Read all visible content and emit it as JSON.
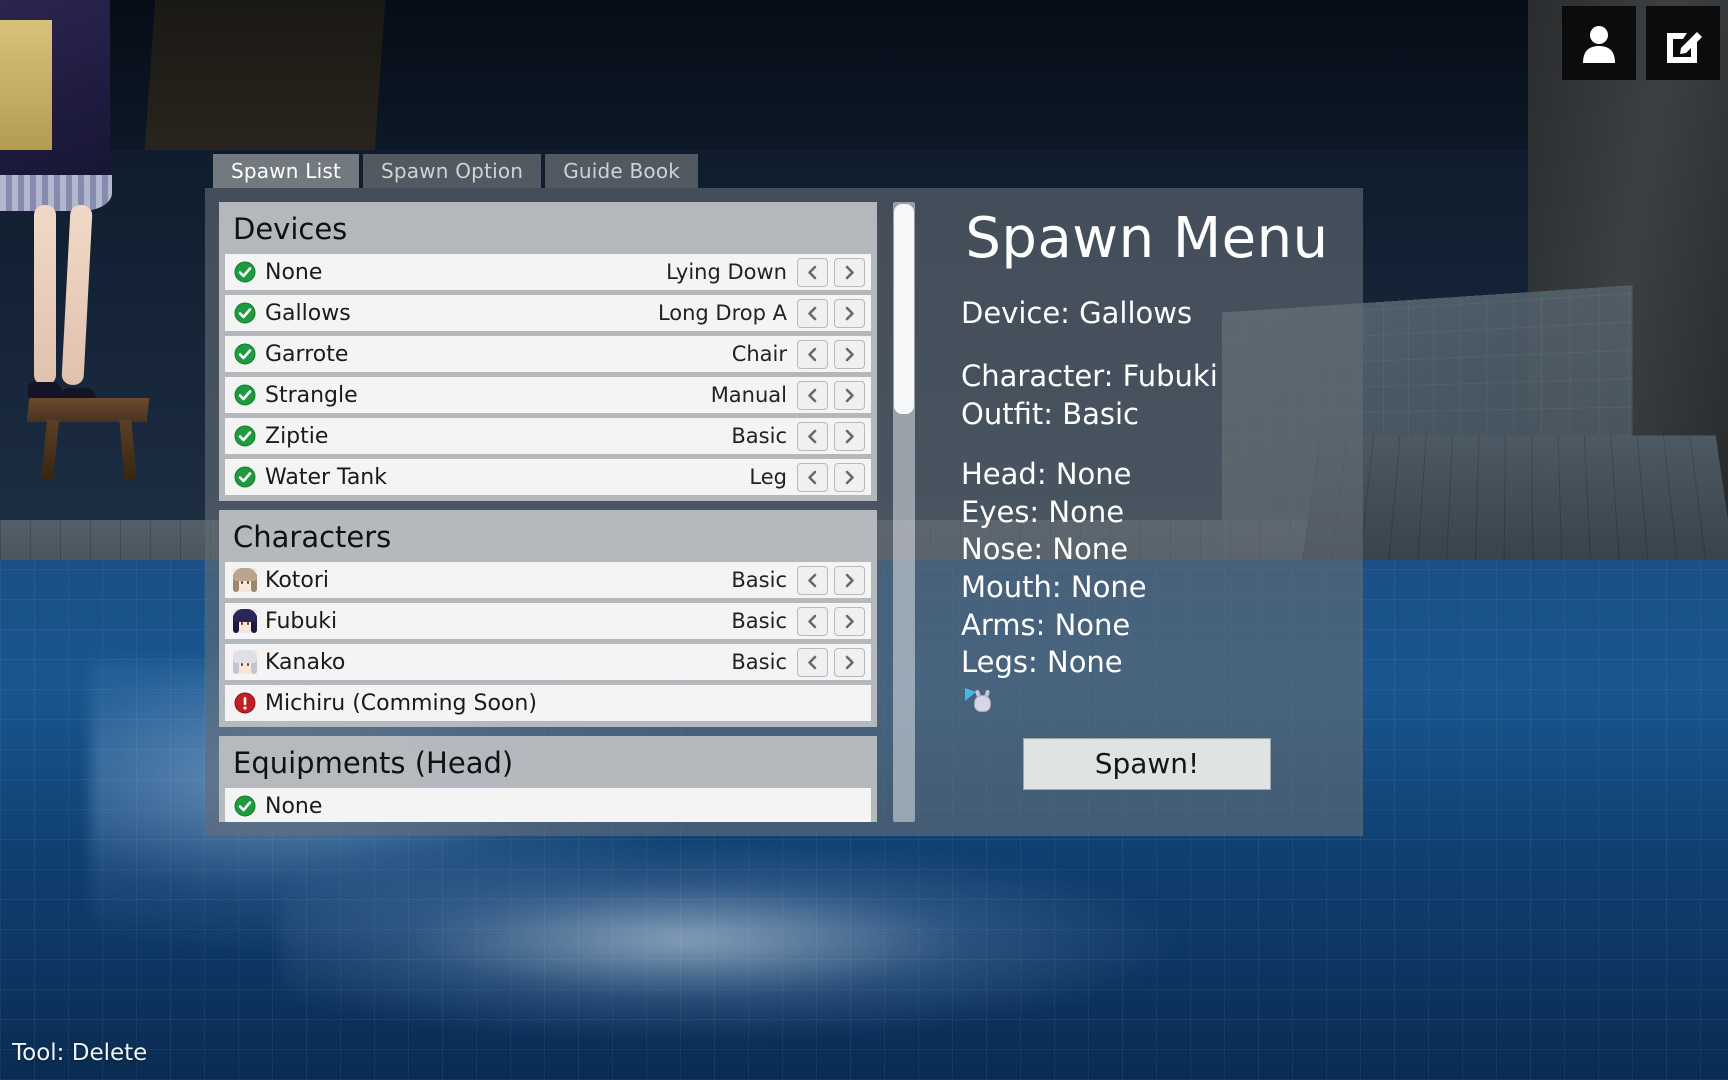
{
  "topbar": {
    "profile_icon": "person-icon",
    "edit_icon": "edit-compose-icon"
  },
  "tabs": [
    {
      "label": "Spawn List",
      "active": true
    },
    {
      "label": "Spawn Option",
      "active": false
    },
    {
      "label": "Guide Book",
      "active": false
    }
  ],
  "list": {
    "groups": [
      {
        "title": "Devices",
        "rows": [
          {
            "icon": "green-check-icon",
            "label": "None",
            "value": "Lying Down",
            "arrows": true
          },
          {
            "icon": "green-check-icon",
            "label": "Gallows",
            "value": "Long Drop A",
            "arrows": true
          },
          {
            "icon": "green-check-icon",
            "label": "Garrote",
            "value": "Chair",
            "arrows": true
          },
          {
            "icon": "green-check-icon",
            "label": "Strangle",
            "value": "Manual",
            "arrows": true
          },
          {
            "icon": "green-check-icon",
            "label": "Ziptie",
            "value": "Basic",
            "arrows": true
          },
          {
            "icon": "green-check-icon",
            "label": "Water Tank",
            "value": "Leg",
            "arrows": true
          }
        ]
      },
      {
        "title": "Characters",
        "rows": [
          {
            "icon": "avatar-kotori",
            "label": "Kotori",
            "value": "Basic",
            "arrows": true
          },
          {
            "icon": "avatar-fubuki",
            "label": "Fubuki",
            "value": "Basic",
            "arrows": true
          },
          {
            "icon": "avatar-kanako",
            "label": "Kanako",
            "value": "Basic",
            "arrows": true
          },
          {
            "icon": "red-warning-icon",
            "label": "Michiru (Comming Soon)",
            "value": "",
            "arrows": false
          }
        ]
      },
      {
        "title": "Equipments (Head)",
        "rows": [
          {
            "icon": "green-check-icon",
            "label": "None",
            "value": "",
            "arrows": false
          }
        ]
      }
    ],
    "scroll_position": "top"
  },
  "info": {
    "title": "Spawn Menu",
    "device": "Device: Gallows",
    "character": "Character: Fubuki",
    "outfit": "Outfit: Basic",
    "head": "Head: None",
    "eyes": "Eyes: None",
    "nose": "Nose: None",
    "mouth": "Mouth: None",
    "arms": "Arms: None",
    "legs": "Legs: None",
    "preview_icon": "character-preview-thumbnail",
    "spawn_button": "Spawn!"
  },
  "status": {
    "tool": "Tool: Delete"
  },
  "colors": {
    "accent_green": "#1f9b3f",
    "warning_red": "#c02024",
    "panel_bg": "#656d74",
    "row_bg": "#f4f4f4",
    "group_bg": "#babec2"
  }
}
